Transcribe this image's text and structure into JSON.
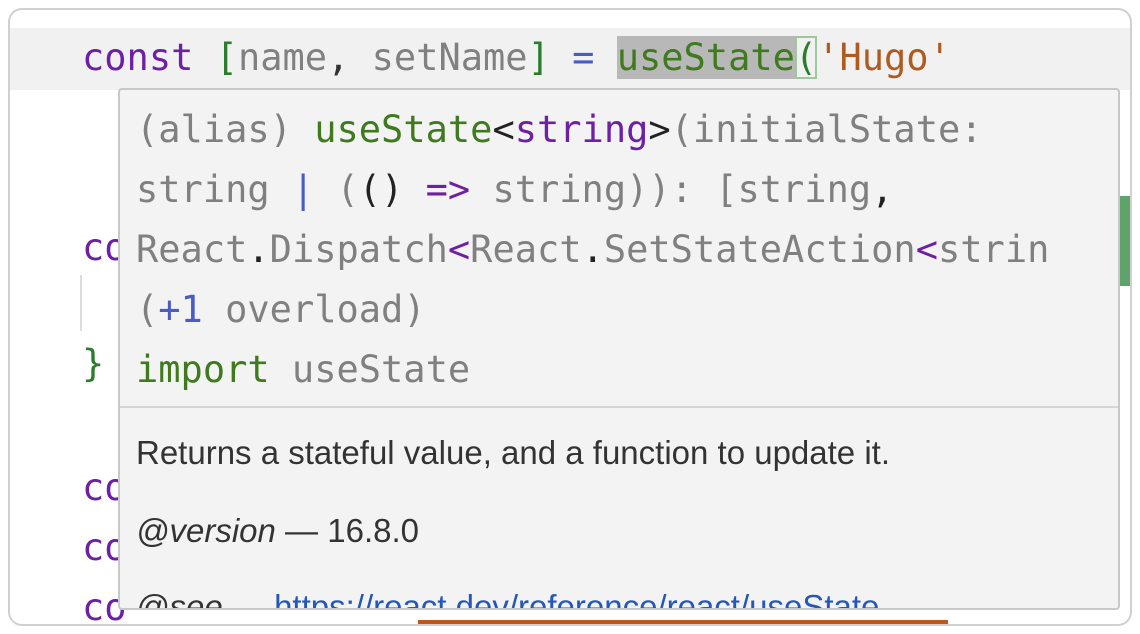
{
  "code_lines": [
    {
      "kw": "const",
      "bracket_open": "[",
      "ident1": "name",
      "comma": ",",
      "ident2": "setName",
      "bracket_close": "]",
      "eq": "=",
      "fn": "useState",
      "paren": "(",
      "str": "'Hugo'"
    },
    {
      "text": "co"
    },
    {
      "text": "}"
    },
    {
      "text": "co"
    },
    {
      "text": "co"
    },
    {
      "text": "co"
    }
  ],
  "hover": {
    "signature": {
      "l1_alias": "(alias) ",
      "l1_fn": "useState",
      "l1_lt": "<",
      "l1_type": "string",
      "l1_gt": ">",
      "l1_rest": "(initialState:",
      "l2_a": "string ",
      "l2_pipe": "|",
      "l2_b": " (",
      "l2_paren": "()",
      "l2_arrow": " =>",
      "l2_c": " string)): [string",
      "l2_comma": ",",
      "l3_a": "React",
      "l3_dot1": ".",
      "l3_b": "Dispatch",
      "l3_lt1": "<",
      "l3_c": "React",
      "l3_dot2": ".",
      "l3_d": "SetStateAction",
      "l3_lt2": "<",
      "l3_e": "strin",
      "l4_a": "(",
      "l4_num": "+1",
      "l4_b": " overload)",
      "l5_import": "import",
      "l5_rest": " useState"
    },
    "doc": {
      "description": "Returns a stateful value, and a function to update it.",
      "version_tag": "@version",
      "version_sep": " — ",
      "version_value": "16.8.0",
      "see_tag": "@see",
      "see_sep": " — ",
      "see_link": "https://react.dev/reference/react/useState"
    }
  },
  "colors": {
    "keyword": "#6f1fa3",
    "function": "#3f7a1e",
    "string": "#b05a1f",
    "operator": "#4a5cc4",
    "link": "#2457b8"
  }
}
